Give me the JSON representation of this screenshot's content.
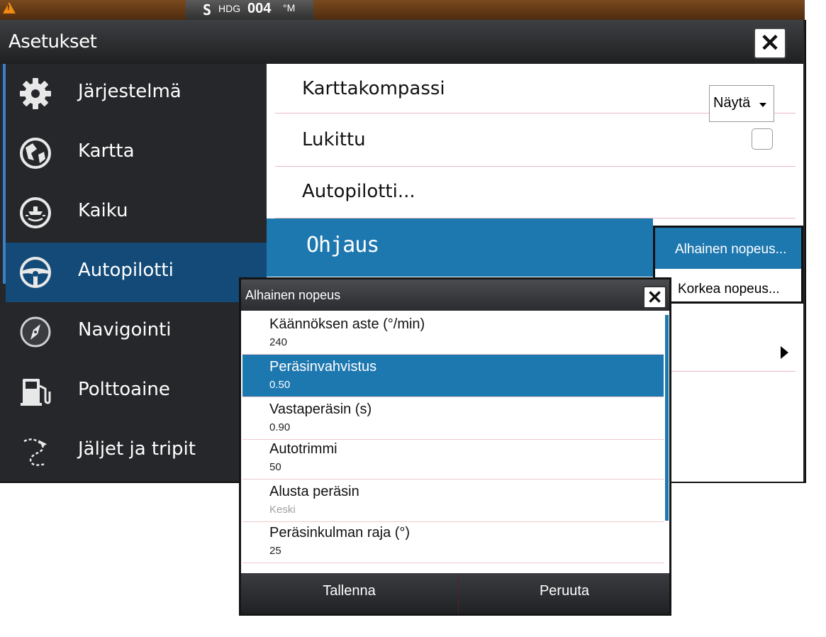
{
  "status_bar": {
    "warning_icon": "warning-triangle-icon",
    "heading_prefix": "S",
    "heading_label": "HDG",
    "heading_value": "004",
    "heading_unit": "°M"
  },
  "window": {
    "title": "Asetukset",
    "close_label": "✕"
  },
  "sidebar": {
    "items": [
      {
        "label": "Järjestelmä",
        "icon": "gear-icon"
      },
      {
        "label": "Kartta",
        "icon": "chart-globe-icon"
      },
      {
        "label": "Kaiku",
        "icon": "sonar-icon"
      },
      {
        "label": "Autopilotti",
        "icon": "steering-wheel-icon",
        "active": true
      },
      {
        "label": "Navigointi",
        "icon": "compass-icon"
      },
      {
        "label": "Polttoaine",
        "icon": "fuel-pump-icon"
      },
      {
        "label": "Jäljet ja tripit",
        "icon": "trail-icon"
      }
    ]
  },
  "pane": {
    "rows": [
      {
        "label": "Karttakompassi",
        "control": "dropdown",
        "value": "Näytä"
      },
      {
        "label": "Lukittu",
        "control": "checkbox",
        "checked": false
      },
      {
        "label": "Autopilotti..."
      },
      {
        "label": "Ohjaus",
        "highlighted": true
      }
    ]
  },
  "submenu": {
    "items": [
      "Alhainen nopeus...",
      "Korkea nopeus..."
    ]
  },
  "dialog": {
    "title": "Alhainen nopeus",
    "close_label": "✕",
    "rows": [
      {
        "name": "Käännöksen aste (°/min)",
        "value": "240"
      },
      {
        "name": "Peräsinvahvistus",
        "value": "0.50",
        "selected": true
      },
      {
        "name": "Vastaperäsin (s)",
        "value": "0.90"
      },
      {
        "name": "Autotrimmi",
        "value": "50"
      },
      {
        "name": "Alusta peräsin",
        "value": "Keski",
        "disabled": true
      },
      {
        "name": "Peräsinkulman raja  (°)",
        "value": "25"
      }
    ],
    "save_label": "Tallenna",
    "cancel_label": "Peruuta"
  },
  "colors": {
    "accent": "#1e78b0",
    "sidebar_bg": "#25272a",
    "status_bar": "#6a3e18"
  }
}
